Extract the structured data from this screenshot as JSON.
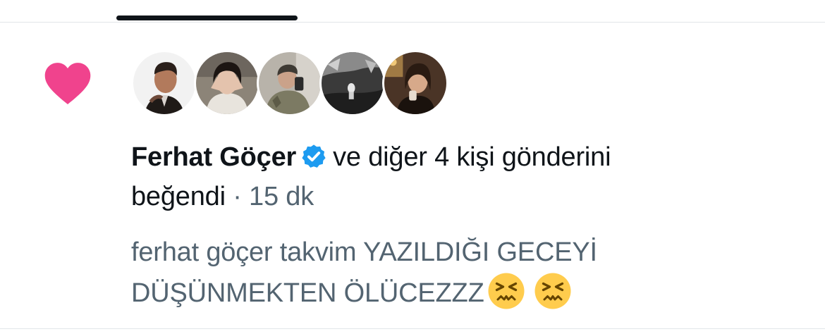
{
  "notification": {
    "type_icon": "heart-icon",
    "type_color": "#f0438d",
    "avatars": [
      {
        "name": "avatar-1"
      },
      {
        "name": "avatar-2"
      },
      {
        "name": "avatar-3"
      },
      {
        "name": "avatar-4"
      },
      {
        "name": "avatar-5"
      }
    ],
    "user_name": "Ferhat Göçer",
    "verified_icon": "verified-badge-icon",
    "verified_color": "#1d9bf0",
    "action_text": "ve diğer 4 kişi gönderini",
    "action_text_2": "beğendi",
    "separator": "·",
    "timestamp": "15 dk",
    "tweet_text_line1": "ferhat göçer takvim YAZILDIĞI GECEYİ",
    "tweet_text_line2": "DÜŞÜNMEKTEN ÖLÜCEZZZ",
    "emoji_icon": "confounded-face-icon"
  },
  "colors": {
    "primary_text": "#0f1419",
    "secondary_text": "#536471",
    "divider": "#e1e5e9"
  }
}
